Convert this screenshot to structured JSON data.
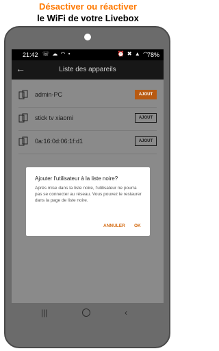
{
  "promo": {
    "line1": "Désactiver ou réactiver",
    "line2": "le WiFi de votre Livebox"
  },
  "statusbar": {
    "time": "21:42",
    "battery": "78%"
  },
  "appbar": {
    "title": "Liste des appareils"
  },
  "devices": [
    {
      "name": "admin-PC",
      "button": "AJOUT"
    },
    {
      "name": "stick tv xiaomi",
      "button": "AJOUT"
    },
    {
      "name": "0a:16:0d:06:1f:d1",
      "button": "AJOUT"
    }
  ],
  "dialog": {
    "title": "Ajouter l'utilisateur à la liste noire?",
    "body": "Après mise dans la liste noire, l'utilisateur ne pourra pas se connecter au réseau. Vous pouvez le restaurer dans la page de liste noire.",
    "cancel": "ANNULER",
    "ok": "OK"
  },
  "colors": {
    "accent": "#ff7900",
    "dialog_button": "#d46a10"
  }
}
